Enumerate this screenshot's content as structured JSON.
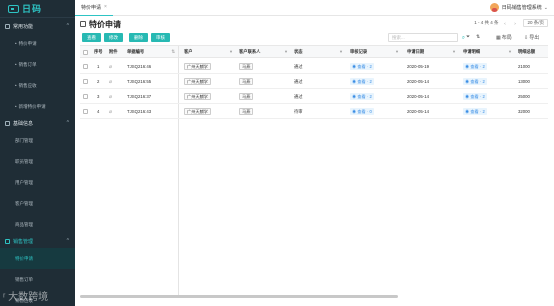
{
  "app": {
    "logo_text": "日码",
    "watermark": "ʳ 大数跨境"
  },
  "sidebar": {
    "groups": [
      {
        "label": "常用功能",
        "chev": "^",
        "items": [
          "特价申请",
          "销售订单",
          "销售应收",
          "新增特价申请"
        ]
      },
      {
        "label": "基础信息",
        "chev": "^",
        "items": [
          "部门管理",
          "职员管理",
          "用户管理",
          "客户管理",
          "商品管理"
        ]
      },
      {
        "label": "销售管理",
        "chev": "^",
        "items": [
          "特价申请",
          "销售订单",
          "销售应收"
        ]
      }
    ]
  },
  "topbar": {
    "tab_label": "特价申请",
    "tab_close": "×",
    "user_name": "日码销售管理系统",
    "user_caret": "⌄"
  },
  "page": {
    "title": "特价申请",
    "pager_range": "1 - 4 共 4 条",
    "pager_prev": "‹",
    "pager_next": "›",
    "page_size": "20 条/页"
  },
  "toolbar": {
    "buttons": [
      "查看",
      "修改",
      "删除",
      "审核"
    ],
    "search_placeholder": "搜索...",
    "search_icon": "⌕",
    "filter_icon": "⏷",
    "sort_icon": "⇅",
    "layout_label": "布局",
    "export_label": "导出"
  },
  "table": {
    "columns": [
      "序号",
      "附件",
      "单据编号",
      "客户",
      "客户联系人",
      "状态",
      "审核记录",
      "申请日期",
      "申请明细",
      "明细总额"
    ],
    "rows": [
      {
        "index": "1",
        "doc_no": "TJSQ216:46",
        "customer": "广州天麒学",
        "contact": "马燕",
        "status": "通过",
        "audit": "◉ 查看 · 2",
        "date": "2020-05-19",
        "detail": "◉ 查看 · 2",
        "total": "21000"
      },
      {
        "index": "2",
        "doc_no": "TJSQ216:55",
        "customer": "广州天麒学",
        "contact": "马燕",
        "status": "通过",
        "audit": "◉ 查看 · 2",
        "date": "2020-05-14",
        "detail": "◉ 查看 · 2",
        "total": "13000"
      },
      {
        "index": "3",
        "doc_no": "TJSQ216:37",
        "customer": "广州天麒学",
        "contact": "马燕",
        "status": "通过",
        "audit": "◉ 查看 · 2",
        "date": "2020-05-14",
        "detail": "◉ 查看 · 2",
        "total": "25000"
      },
      {
        "index": "4",
        "doc_no": "TJSQ216:43",
        "customer": "广州天麒学",
        "contact": "马燕",
        "status": "待审",
        "audit": "◉ 查看 · 0",
        "date": "2020-05-14",
        "detail": "◉ 查看 · 2",
        "total": "32000"
      }
    ]
  },
  "colors": {
    "accent": "#27b9b3",
    "sidebar_bg": "#1f2d36",
    "link_blue": "#3a8ee6"
  }
}
